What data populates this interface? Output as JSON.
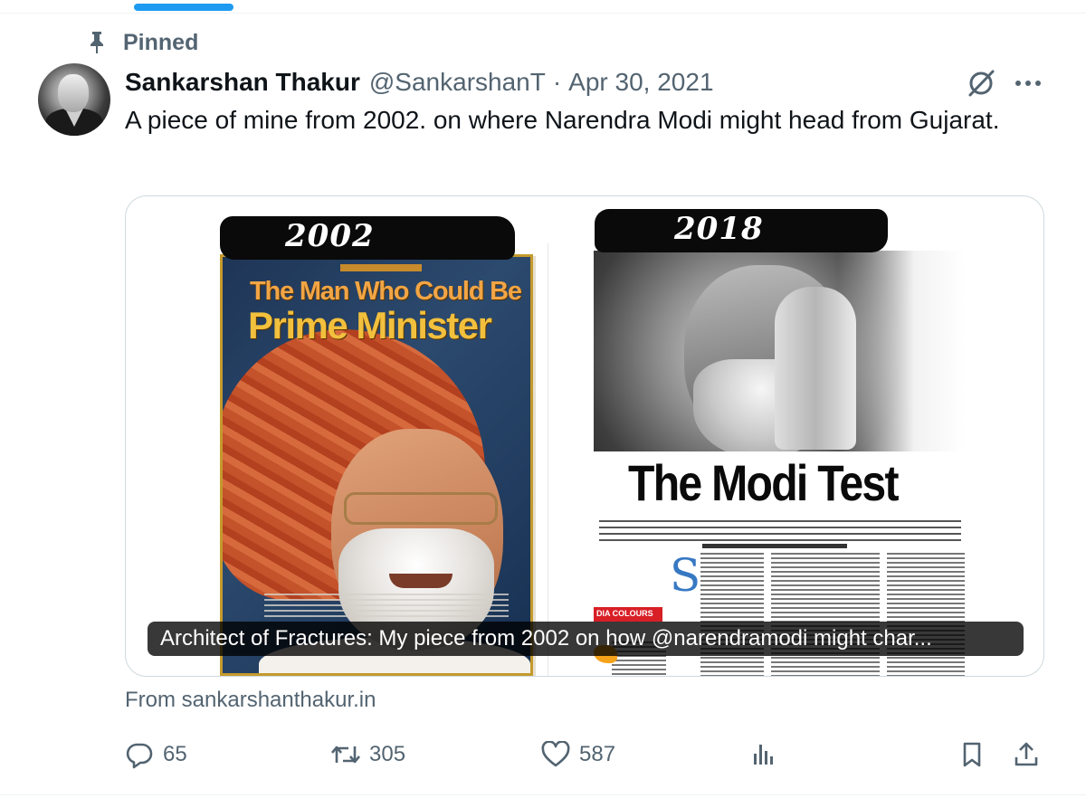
{
  "pinned": {
    "label": "Pinned",
    "icon": "pin-icon"
  },
  "author": {
    "name": "Sankarshan Thakur",
    "handle": "@SankarshanT",
    "separator": "·",
    "date": "Apr 30, 2021",
    "avatar_icon": "avatar"
  },
  "post": {
    "text": "A piece of mine from 2002. on where Narendra Modi might head from Gujarat."
  },
  "media": {
    "left_year": "2002",
    "right_year": "2018",
    "left_headline_line1": "The Man Who Could Be",
    "left_headline_line2": "Prime Minister",
    "right_headline": "The Modi Test",
    "right_tag": "DIA COLOURS",
    "right_dropcap": "S",
    "caption": "Architect of Fractures: My piece from 2002 on how @narendramodi might char..."
  },
  "link_source": "From sankarshanthakur.in",
  "actions": {
    "reply_count": "65",
    "repost_count": "305",
    "like_count": "587",
    "icons": [
      "reply-icon",
      "repost-icon",
      "like-icon",
      "views-icon",
      "bookmark-icon",
      "share-icon"
    ]
  },
  "colors": {
    "text_primary": "#0f1419",
    "text_secondary": "#536471",
    "accent": "#1d9bf0",
    "border": "#cfd9de"
  }
}
